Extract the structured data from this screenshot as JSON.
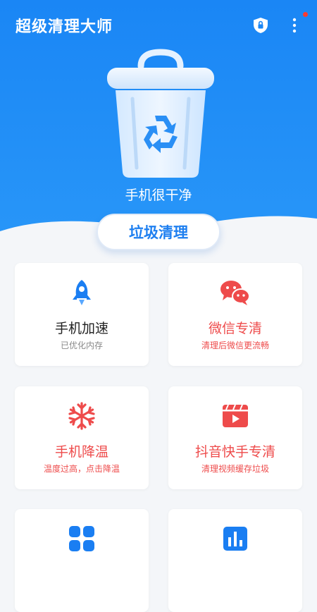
{
  "header": {
    "title": "超级清理大师",
    "status": "手机很干净",
    "clean_button": "垃圾清理"
  },
  "icons": {
    "shield": "shield-lock-icon",
    "more": "more-vertical-icon",
    "trash": "recycle-trash-can-icon"
  },
  "colors": {
    "primary": "#1a86f5",
    "accent_red": "#ee4b4b",
    "card_bg": "#ffffff"
  },
  "cards": [
    {
      "title": "手机加速",
      "subtitle": "已优化内存",
      "icon": "rocket-icon",
      "alert": false
    },
    {
      "title": "微信专清",
      "subtitle": "清理后微信更流畅",
      "icon": "wechat-icon",
      "alert": true
    },
    {
      "title": "手机降温",
      "subtitle": "温度过高，点击降温",
      "icon": "snowflake-icon",
      "alert": true
    },
    {
      "title": "抖音快手专清",
      "subtitle": "清理视频缓存垃圾",
      "icon": "video-icon",
      "alert": true
    },
    {
      "title": "",
      "subtitle": "",
      "icon": "app-grid-icon",
      "alert": false
    },
    {
      "title": "",
      "subtitle": "",
      "icon": "bar-chart-icon",
      "alert": false
    }
  ]
}
